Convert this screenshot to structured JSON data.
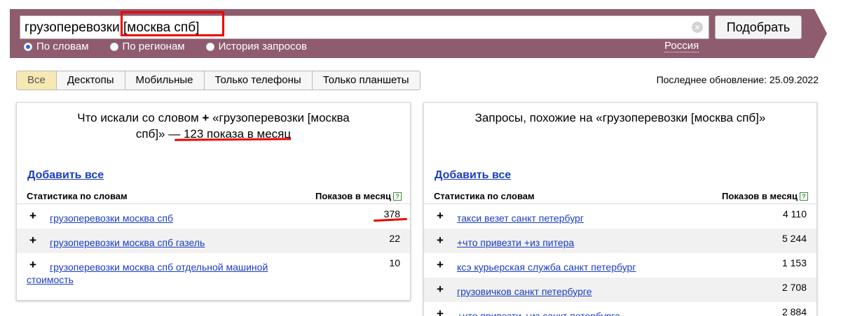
{
  "search": {
    "query": "грузоперевозки [москва спб]",
    "submit_label": "Подобрать",
    "modes": [
      {
        "label": "По словам",
        "checked": true
      },
      {
        "label": "По регионам",
        "checked": false
      },
      {
        "label": "История запросов",
        "checked": false
      }
    ],
    "region": "Россия"
  },
  "tabs": [
    {
      "label": "Все",
      "active": true
    },
    {
      "label": "Десктопы",
      "active": false
    },
    {
      "label": "Мобильные",
      "active": false
    },
    {
      "label": "Только телефоны",
      "active": false
    },
    {
      "label": "Только планшеты",
      "active": false
    }
  ],
  "last_update": "Последнее обновление: 25.09.2022",
  "left_panel": {
    "title_prefix": "Что искали со словом",
    "title_plus": "+",
    "title_query": "«грузоперевозки [москва",
    "title_line2_a": "спб]» — ",
    "title_count": "123 показа в месяц",
    "add_all": "Добавить все",
    "col_phrase": "Статистика по словам",
    "col_count": "Показов в месяц",
    "help": "?",
    "rows": [
      {
        "phrase": "грузоперевозки москва спб",
        "count": "378"
      },
      {
        "phrase": "грузоперевозки москва спб газель",
        "count": "22"
      },
      {
        "phrase": "грузоперевозки москва спб отдельной машиной стоимость",
        "count": "10"
      }
    ]
  },
  "right_panel": {
    "title": "Запросы, похожие на «грузоперевозки [москва спб]»",
    "add_all": "Добавить все",
    "col_phrase": "Статистика по словам",
    "col_count": "Показов в месяц",
    "help": "?",
    "rows": [
      {
        "phrase": "такси везет санкт петербург",
        "count": "4 110"
      },
      {
        "phrase": "+что привезти +из питера",
        "count": "5 244"
      },
      {
        "phrase": "ксэ курьерская служба санкт петербург",
        "count": "1 153"
      },
      {
        "phrase": "грузовичков санкт петербурге",
        "count": "2 708"
      },
      {
        "phrase": "+что привезти +из санкт петербурга",
        "count": "2 884"
      }
    ]
  },
  "icons": {
    "clear": "×",
    "plus": "+"
  },
  "colors": {
    "header": "#8e5b6f",
    "link": "#1a3dc1",
    "highlight": "#e00000",
    "active_tab": "#f6e8b3"
  }
}
